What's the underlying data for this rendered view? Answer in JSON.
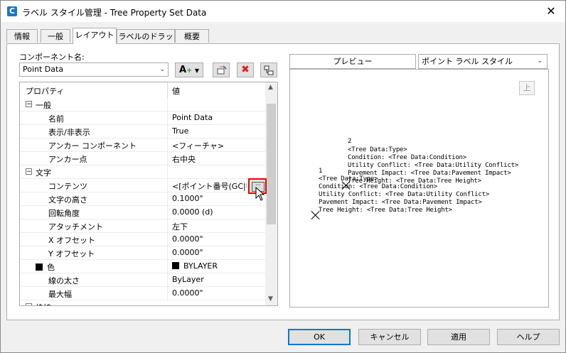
{
  "window": {
    "title": "ラベル スタイル管理 - Tree Property Set Data",
    "app_icon": "C"
  },
  "tabs": [
    {
      "label": "情報"
    },
    {
      "label": "一般"
    },
    {
      "label": "レイアウト"
    },
    {
      "label": "ラベルのドラッグ"
    },
    {
      "label": "概要"
    }
  ],
  "active_tab": "レイアウト",
  "component": {
    "label": "コンポーネント名:",
    "value": "Point Data"
  },
  "grid": {
    "headers": {
      "property": "プロパティ",
      "value": "値"
    },
    "rows": [
      {
        "type": "cat",
        "name": "一般",
        "value": ""
      },
      {
        "type": "prop",
        "name": "名前",
        "value": "Point Data"
      },
      {
        "type": "prop",
        "name": "表示/非表示",
        "value": "True"
      },
      {
        "type": "prop",
        "name": "アンカー コンポーネント",
        "value": "<フィーチャ>"
      },
      {
        "type": "prop",
        "name": "アンカー点",
        "value": "右中央"
      },
      {
        "type": "cat",
        "name": "文字",
        "value": ""
      },
      {
        "type": "prop",
        "name": "コンテンツ",
        "value": "<[ポイント番号(GC|UN"
      },
      {
        "type": "prop",
        "name": "文字の高さ",
        "value": "0.1000\""
      },
      {
        "type": "prop",
        "name": "回転角度",
        "value": "0.0000 (d)"
      },
      {
        "type": "prop",
        "name": "アタッチメント",
        "value": "左下"
      },
      {
        "type": "prop",
        "name": "X オフセット",
        "value": "0.0000\""
      },
      {
        "type": "prop",
        "name": "Y オフセット",
        "value": "0.0000\""
      },
      {
        "type": "prop",
        "name": "色",
        "value": "BYLAYER"
      },
      {
        "type": "prop",
        "name": "線の太さ",
        "value": "ByLayer"
      },
      {
        "type": "prop",
        "name": "最大幅",
        "value": "0.0000\""
      },
      {
        "type": "cat",
        "name": "枠線",
        "value": ""
      }
    ]
  },
  "preview": {
    "header": "プレビュー",
    "style_select": "ポイント ラベル スタイル",
    "up_button": "上",
    "label_a": [
      "2",
      "<Tree Data:Type>",
      "Condition: <Tree Data:Condition>",
      "Utility Conflict: <Tree Data:Utility Conflict>",
      "Pavement Impact: <Tree Data:Pavement Impact>",
      "Tree Height: <Tree Data:Tree Height>"
    ],
    "label_b": [
      "1",
      "<Tree Data:Type>",
      "Condition: <Tree Data:Condition>",
      "Utility Conflict: <Tree Data:Utility Conflict>",
      "Pavement Impact: <Tree Data:Pavement Impact>",
      "Tree Height: <Tree Data:Tree Height>"
    ]
  },
  "buttons": {
    "ok": "OK",
    "cancel": "キャンセル",
    "apply": "適用",
    "help": "ヘルプ"
  }
}
